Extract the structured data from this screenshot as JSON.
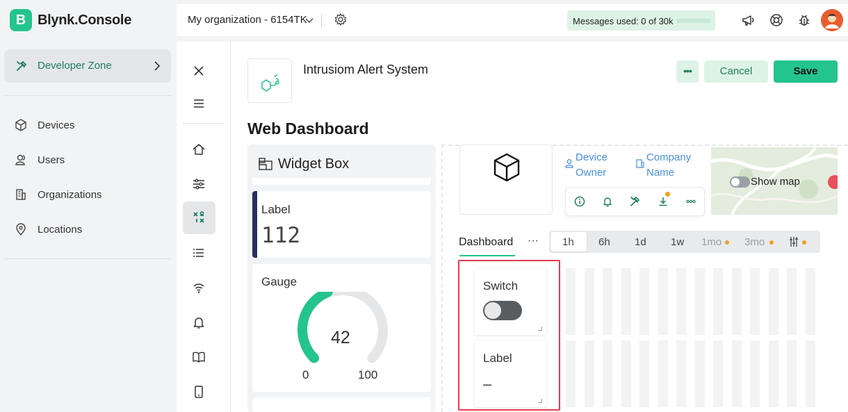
{
  "brand": {
    "logo_letter": "B",
    "name": "Blynk.Console",
    "accent": "#23c48e"
  },
  "sidebar": {
    "developer_zone": "Developer Zone",
    "items": [
      {
        "label": "Devices",
        "icon": "cube-icon"
      },
      {
        "label": "Users",
        "icon": "users-icon"
      },
      {
        "label": "Organizations",
        "icon": "building-icon"
      },
      {
        "label": "Locations",
        "icon": "location-pin-icon"
      }
    ]
  },
  "topbar": {
    "org": "My organization - 6154TK",
    "messages": "Messages used: 0 of 30k",
    "messages_usage_fraction": 0,
    "icons": [
      "megaphone-icon",
      "help-lifebuoy-icon",
      "bug-icon",
      "avatar"
    ]
  },
  "template": {
    "name": "Intrusiom Alert System",
    "more_label": "•••",
    "cancel_label": "Cancel",
    "save_label": "Save"
  },
  "page_title": "Web Dashboard",
  "widget_box": {
    "title": "Widget Box",
    "label_card": {
      "title": "Label",
      "value": "112"
    },
    "gauge_card": {
      "title": "Gauge",
      "value": "42",
      "min": "0",
      "max": "100",
      "fill_fraction": 0.42
    }
  },
  "device": {
    "owner_label": "Device Owner",
    "company_label": "Company Name",
    "show_map": "Show map",
    "actions": [
      "info-icon",
      "bell-icon",
      "wrench-icon",
      "download-icon",
      "more-icon"
    ]
  },
  "dashboard": {
    "tab": "Dashboard",
    "tab_more": "···",
    "ranges": [
      {
        "label": "1h",
        "active": true,
        "pro": false
      },
      {
        "label": "6h",
        "active": false,
        "pro": false
      },
      {
        "label": "1d",
        "active": false,
        "pro": false
      },
      {
        "label": "1w",
        "active": false,
        "pro": false
      },
      {
        "label": "1mo",
        "active": false,
        "pro": true
      },
      {
        "label": "3mo",
        "active": false,
        "pro": true
      }
    ]
  },
  "widgets": {
    "switch": {
      "title": "Switch",
      "state": "off"
    },
    "label": {
      "title": "Label",
      "value": "–"
    }
  },
  "colors": {
    "highlight": "#e8384f",
    "link": "#4a8fe0",
    "pro_dot": "#f0a020"
  }
}
